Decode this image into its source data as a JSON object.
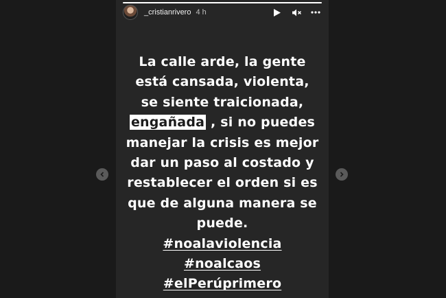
{
  "story": {
    "username": "_cristianrivero",
    "time": "4 h",
    "progress_fraction": 1.0,
    "lines": [
      [
        "La calle arde, la gente"
      ],
      [
        "está cansada, violenta,"
      ],
      [
        "se siente traicionada,"
      ],
      [
        "engañada",
        " , si no puedes"
      ],
      [
        "manejar la crisis es mejor"
      ],
      [
        "dar un paso al costado y"
      ],
      [
        "restablecer el orden si es"
      ],
      [
        "que de alguna manera se"
      ],
      [
        "puede."
      ]
    ],
    "hashtags": [
      "#noalaviolencia",
      "#noalcaos",
      "#elPerúprimero"
    ]
  },
  "icons": {
    "play": "play-icon",
    "mute": "mute-icon",
    "more": "more-icon",
    "prev": "chevron-left-icon",
    "next": "chevron-right-icon"
  },
  "colors": {
    "story_background": "#262626",
    "page_background": "#1a1a1a",
    "text": "#ffffff",
    "highlight": "#ffffff"
  }
}
